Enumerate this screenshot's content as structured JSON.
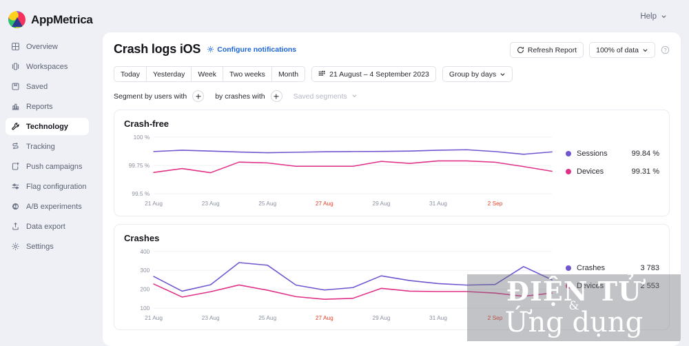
{
  "brand": {
    "name": "AppMetrica",
    "logo_icon": "appmetrica-logo-icon"
  },
  "sidebar": {
    "items": [
      {
        "label": "Overview",
        "icon": "grid-icon",
        "active": false
      },
      {
        "label": "Workspaces",
        "icon": "workspaces-icon",
        "active": false
      },
      {
        "label": "Saved",
        "icon": "bookmark-square-icon",
        "active": false
      },
      {
        "label": "Reports",
        "icon": "bar-chart-icon",
        "active": false
      },
      {
        "label": "Technology",
        "icon": "wrench-icon",
        "active": true
      },
      {
        "label": "Tracking",
        "icon": "tracking-arrows-icon",
        "active": false
      },
      {
        "label": "Push campaigns",
        "icon": "push-upload-icon",
        "active": false
      },
      {
        "label": "Flag configuration",
        "icon": "sliders-icon",
        "active": false
      },
      {
        "label": "A/B experiments",
        "icon": "ab-circle-icon",
        "active": false
      },
      {
        "label": "Data export",
        "icon": "export-up-icon",
        "active": false
      },
      {
        "label": "Settings",
        "icon": "gear-icon",
        "active": false
      }
    ]
  },
  "topbar": {
    "help_label": "Help",
    "help_chevron_icon": "chevron-down-icon"
  },
  "header": {
    "title": "Crash logs iOS",
    "configure_link": "Configure notifications",
    "configure_icon": "gear-icon",
    "refresh_label": "Refresh Report",
    "refresh_icon": "refresh-icon",
    "data_sampling_label": "100% of data",
    "data_sampling_chevron": "chevron-down-icon",
    "help_info_icon": "question-circle-icon"
  },
  "period_tabs": [
    {
      "label": "Today"
    },
    {
      "label": "Yesterday"
    },
    {
      "label": "Week"
    },
    {
      "label": "Two weeks"
    },
    {
      "label": "Month"
    }
  ],
  "date_range": {
    "label": "21 August – 4 September 2023",
    "icon": "calendar-icon"
  },
  "group_by": {
    "label": "Group by days",
    "chevron_icon": "chevron-down-icon"
  },
  "segment_bar": {
    "by_users_label": "Segment by users with",
    "by_crashes_label": "by crashes with",
    "add_icon": "plus-icon",
    "saved_segments_label": "Saved segments",
    "saved_segments_chevron": "chevron-down-icon"
  },
  "colors": {
    "sessions": "#6f55cf",
    "devices": "#e03087",
    "accent_link": "#1a64d6",
    "weekend_tick": "#e8402a",
    "page_bg": "#eef0f5",
    "card_bg": "#ffffff"
  },
  "watermark": {
    "line1": "ĐIỆN TỬ",
    "amp": "&",
    "line2": "Ứng dụng"
  },
  "chart_data": [
    {
      "id": "crash-free",
      "type": "line",
      "title": "Crash-free",
      "xlabel": "",
      "ylabel": "",
      "ylim": [
        99.5,
        100
      ],
      "yticks": [
        "99.5 %",
        "99.75 %",
        "100 %"
      ],
      "ytick_values": [
        99.5,
        99.75,
        100
      ],
      "grid": true,
      "legend_position": "right",
      "x": [
        "21 Aug",
        "22 Aug",
        "23 Aug",
        "24 Aug",
        "25 Aug",
        "26 Aug",
        "27 Aug",
        "28 Aug",
        "29 Aug",
        "30 Aug",
        "31 Aug",
        "1 Sep",
        "2 Sep",
        "3 Sep",
        "4 Sep"
      ],
      "xtick_labels": [
        "21 Aug",
        "23 Aug",
        "25 Aug",
        "27 Aug",
        "29 Aug",
        "31 Aug",
        "2 Sep"
      ],
      "xtick_indices": [
        0,
        2,
        4,
        6,
        8,
        10,
        12
      ],
      "weekend_ticks": [
        "27 Aug",
        "2 Sep"
      ],
      "series": [
        {
          "name": "Sessions",
          "color": "#6f55cf",
          "total": "99.84 %",
          "values": [
            99.872,
            99.884,
            99.876,
            99.868,
            99.862,
            99.866,
            99.87,
            99.872,
            99.873,
            99.876,
            99.884,
            99.888,
            99.872,
            99.848,
            99.869
          ]
        },
        {
          "name": "Devices",
          "color": "#e03087",
          "total": "99.31 %",
          "values": [
            99.688,
            99.722,
            99.686,
            99.779,
            99.772,
            99.742,
            99.742,
            99.742,
            99.786,
            99.768,
            99.79,
            99.79,
            99.778,
            99.74,
            99.698
          ]
        }
      ]
    },
    {
      "id": "crashes",
      "type": "line",
      "title": "Crashes",
      "xlabel": "",
      "ylabel": "",
      "ylim": [
        100,
        400
      ],
      "yticks": [
        "100",
        "200",
        "300",
        "400"
      ],
      "ytick_values": [
        100,
        200,
        300,
        400
      ],
      "grid": true,
      "legend_position": "right",
      "x": [
        "21 Aug",
        "22 Aug",
        "23 Aug",
        "24 Aug",
        "25 Aug",
        "26 Aug",
        "27 Aug",
        "28 Aug",
        "29 Aug",
        "30 Aug",
        "31 Aug",
        "1 Sep",
        "2 Sep",
        "3 Sep",
        "4 Sep"
      ],
      "xtick_labels": [
        "21 Aug",
        "23 Aug",
        "25 Aug",
        "27 Aug",
        "29 Aug",
        "31 Aug",
        "2 Sep"
      ],
      "xtick_indices": [
        0,
        2,
        4,
        6,
        8,
        10,
        12
      ],
      "weekend_ticks": [
        "27 Aug",
        "2 Sep"
      ],
      "series": [
        {
          "name": "Crashes",
          "color": "#6f55cf",
          "total": "3 783",
          "values": [
            268,
            190,
            224,
            341,
            327,
            222,
            196,
            209,
            271,
            246,
            230,
            222,
            225,
            320,
            250
          ]
        },
        {
          "name": "Devices",
          "color": "#e03087",
          "total": "2 553",
          "values": [
            228,
            159,
            187,
            223,
            195,
            161,
            147,
            152,
            205,
            190,
            188,
            188,
            180,
            163,
            180
          ]
        }
      ]
    }
  ]
}
